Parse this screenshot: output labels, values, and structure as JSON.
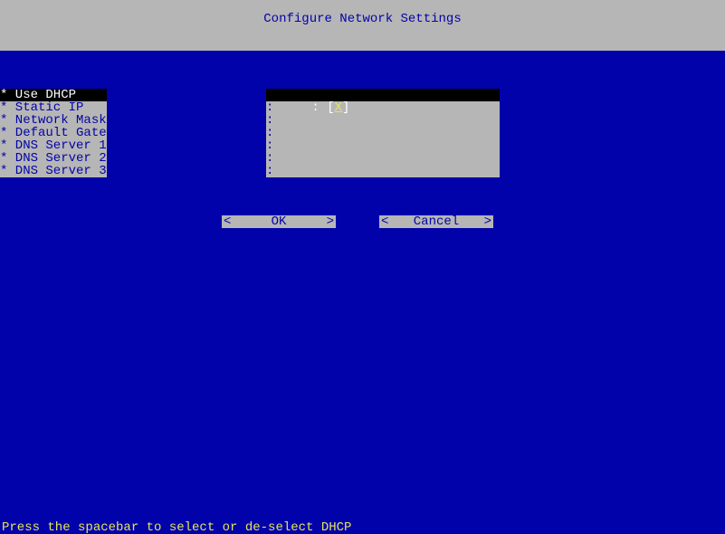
{
  "title": "Configure Network Settings",
  "labels": {
    "use_dhcp": "* Use DHCP",
    "static_ip": "* Static IP",
    "network_mask": "* Network Mask",
    "default_gateway": "* Default Gateway",
    "dns1": "* DNS Server 1",
    "dns2": "* DNS Server 2",
    "dns3": "* DNS Server 3"
  },
  "values": {
    "sep": ":",
    "checkbox_open": "[",
    "checkbox_mark": "X",
    "checkbox_close": "]"
  },
  "buttons": {
    "ok_open": "<",
    "ok_label": "OK",
    "ok_close": ">",
    "cancel_open": "<",
    "cancel_label": "Cancel",
    "cancel_close": ">"
  },
  "status": "Press the spacebar to select or de-select DHCP"
}
